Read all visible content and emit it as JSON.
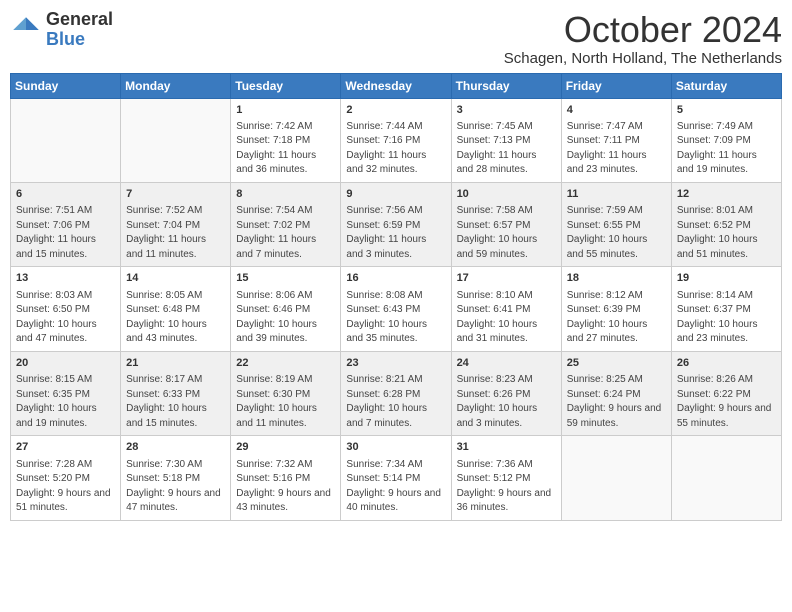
{
  "logo": {
    "general": "General",
    "blue": "Blue"
  },
  "header": {
    "month": "October 2024",
    "location": "Schagen, North Holland, The Netherlands"
  },
  "days_of_week": [
    "Sunday",
    "Monday",
    "Tuesday",
    "Wednesday",
    "Thursday",
    "Friday",
    "Saturday"
  ],
  "weeks": [
    [
      {
        "day": "",
        "info": ""
      },
      {
        "day": "",
        "info": ""
      },
      {
        "day": "1",
        "info": "Sunrise: 7:42 AM\nSunset: 7:18 PM\nDaylight: 11 hours and 36 minutes."
      },
      {
        "day": "2",
        "info": "Sunrise: 7:44 AM\nSunset: 7:16 PM\nDaylight: 11 hours and 32 minutes."
      },
      {
        "day": "3",
        "info": "Sunrise: 7:45 AM\nSunset: 7:13 PM\nDaylight: 11 hours and 28 minutes."
      },
      {
        "day": "4",
        "info": "Sunrise: 7:47 AM\nSunset: 7:11 PM\nDaylight: 11 hours and 23 minutes."
      },
      {
        "day": "5",
        "info": "Sunrise: 7:49 AM\nSunset: 7:09 PM\nDaylight: 11 hours and 19 minutes."
      }
    ],
    [
      {
        "day": "6",
        "info": "Sunrise: 7:51 AM\nSunset: 7:06 PM\nDaylight: 11 hours and 15 minutes."
      },
      {
        "day": "7",
        "info": "Sunrise: 7:52 AM\nSunset: 7:04 PM\nDaylight: 11 hours and 11 minutes."
      },
      {
        "day": "8",
        "info": "Sunrise: 7:54 AM\nSunset: 7:02 PM\nDaylight: 11 hours and 7 minutes."
      },
      {
        "day": "9",
        "info": "Sunrise: 7:56 AM\nSunset: 6:59 PM\nDaylight: 11 hours and 3 minutes."
      },
      {
        "day": "10",
        "info": "Sunrise: 7:58 AM\nSunset: 6:57 PM\nDaylight: 10 hours and 59 minutes."
      },
      {
        "day": "11",
        "info": "Sunrise: 7:59 AM\nSunset: 6:55 PM\nDaylight: 10 hours and 55 minutes."
      },
      {
        "day": "12",
        "info": "Sunrise: 8:01 AM\nSunset: 6:52 PM\nDaylight: 10 hours and 51 minutes."
      }
    ],
    [
      {
        "day": "13",
        "info": "Sunrise: 8:03 AM\nSunset: 6:50 PM\nDaylight: 10 hours and 47 minutes."
      },
      {
        "day": "14",
        "info": "Sunrise: 8:05 AM\nSunset: 6:48 PM\nDaylight: 10 hours and 43 minutes."
      },
      {
        "day": "15",
        "info": "Sunrise: 8:06 AM\nSunset: 6:46 PM\nDaylight: 10 hours and 39 minutes."
      },
      {
        "day": "16",
        "info": "Sunrise: 8:08 AM\nSunset: 6:43 PM\nDaylight: 10 hours and 35 minutes."
      },
      {
        "day": "17",
        "info": "Sunrise: 8:10 AM\nSunset: 6:41 PM\nDaylight: 10 hours and 31 minutes."
      },
      {
        "day": "18",
        "info": "Sunrise: 8:12 AM\nSunset: 6:39 PM\nDaylight: 10 hours and 27 minutes."
      },
      {
        "day": "19",
        "info": "Sunrise: 8:14 AM\nSunset: 6:37 PM\nDaylight: 10 hours and 23 minutes."
      }
    ],
    [
      {
        "day": "20",
        "info": "Sunrise: 8:15 AM\nSunset: 6:35 PM\nDaylight: 10 hours and 19 minutes."
      },
      {
        "day": "21",
        "info": "Sunrise: 8:17 AM\nSunset: 6:33 PM\nDaylight: 10 hours and 15 minutes."
      },
      {
        "day": "22",
        "info": "Sunrise: 8:19 AM\nSunset: 6:30 PM\nDaylight: 10 hours and 11 minutes."
      },
      {
        "day": "23",
        "info": "Sunrise: 8:21 AM\nSunset: 6:28 PM\nDaylight: 10 hours and 7 minutes."
      },
      {
        "day": "24",
        "info": "Sunrise: 8:23 AM\nSunset: 6:26 PM\nDaylight: 10 hours and 3 minutes."
      },
      {
        "day": "25",
        "info": "Sunrise: 8:25 AM\nSunset: 6:24 PM\nDaylight: 9 hours and 59 minutes."
      },
      {
        "day": "26",
        "info": "Sunrise: 8:26 AM\nSunset: 6:22 PM\nDaylight: 9 hours and 55 minutes."
      }
    ],
    [
      {
        "day": "27",
        "info": "Sunrise: 7:28 AM\nSunset: 5:20 PM\nDaylight: 9 hours and 51 minutes."
      },
      {
        "day": "28",
        "info": "Sunrise: 7:30 AM\nSunset: 5:18 PM\nDaylight: 9 hours and 47 minutes."
      },
      {
        "day": "29",
        "info": "Sunrise: 7:32 AM\nSunset: 5:16 PM\nDaylight: 9 hours and 43 minutes."
      },
      {
        "day": "30",
        "info": "Sunrise: 7:34 AM\nSunset: 5:14 PM\nDaylight: 9 hours and 40 minutes."
      },
      {
        "day": "31",
        "info": "Sunrise: 7:36 AM\nSunset: 5:12 PM\nDaylight: 9 hours and 36 minutes."
      },
      {
        "day": "",
        "info": ""
      },
      {
        "day": "",
        "info": ""
      }
    ]
  ]
}
